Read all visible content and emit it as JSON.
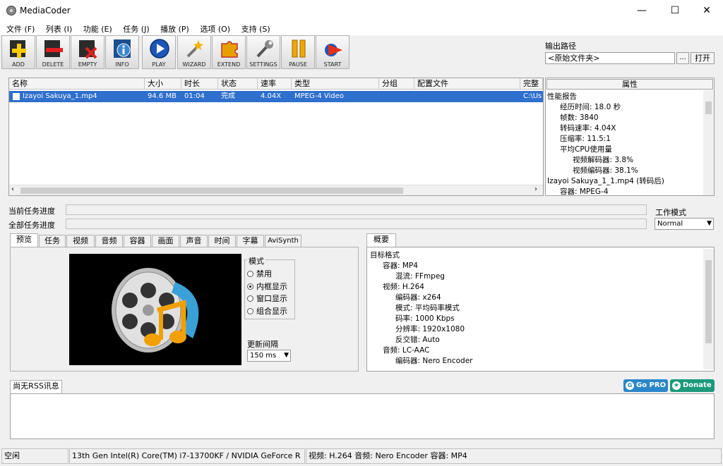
{
  "window": {
    "title": "MediaCoder",
    "minimize": "—",
    "maximize": "☐",
    "close": "✕"
  },
  "menu": [
    "文件 (F)",
    "列表 (I)",
    "功能 (E)",
    "任务 (J)",
    "播放 (P)",
    "选项 (O)",
    "支持 (S)"
  ],
  "toolbar": {
    "add": "ADD",
    "delete": "DELETE",
    "empty": "EMPTY",
    "info": "INFO",
    "play": "PLAY",
    "wizard": "WIZARD",
    "extend": "EXTEND",
    "settings": "SETTINGS",
    "pause": "PAUSE",
    "start": "START"
  },
  "output": {
    "label": "输出路径",
    "value": "<原始文件夹>",
    "browse": "...",
    "open": "打开"
  },
  "filelist": {
    "columns": [
      "名称",
      "大小",
      "时长",
      "状态",
      "速率",
      "类型",
      "分组",
      "配置文件",
      "完整"
    ],
    "rows": [
      {
        "name": "Izayoi Sakuya_1.mp4",
        "size": "94.6 MB",
        "duration": "01:04",
        "status": "完成",
        "rate": "4.04X",
        "type": "MPEG-4 Video",
        "group": "",
        "profile": "",
        "path": "C:\\Us"
      }
    ]
  },
  "properties": {
    "header": "属性",
    "items": [
      "性能报告",
      "经历时间: 18.0 秒",
      "帧数: 3840",
      "转码速率: 4.04X",
      "压缩率: 11.5:1",
      "平均CPU使用量",
      "视频解码器: 3.8%",
      "视频编码器: 38.1%",
      "Izayoi Sakuya_1_1.mp4 (转码后)",
      "容器: MPEG-4"
    ]
  },
  "progress": {
    "current_label": "当前任务进度",
    "total_label": "全部任务进度"
  },
  "work_mode": {
    "label": "工作模式",
    "value": "Normal"
  },
  "tabs": [
    "预览",
    "任务",
    "视频",
    "音频",
    "容器",
    "画面",
    "声音",
    "时间",
    "字幕",
    "AviSynth"
  ],
  "preview": {
    "mode_label": "模式",
    "modes": [
      "禁用",
      "内框显示",
      "窗口显示",
      "组合显示"
    ],
    "update_label": "更新间隔",
    "update_value": "150 ms"
  },
  "summary": {
    "tab": "概要",
    "items": [
      "目标格式",
      "容器: MP4",
      "混流: FFmpeg",
      "视频: H.264",
      "编码器: x264",
      "模式: 平均码率模式",
      "码率: 1000 Kbps",
      "分辨率: 1920x1080",
      "反交错: Auto",
      "音频: LC-AAC",
      "编码器: Nero Encoder"
    ]
  },
  "rss": {
    "tab": "尚无RSS讯息",
    "go_pro": "Go PRO",
    "donate": "Donate"
  },
  "status": {
    "state": "空闲",
    "cpu": "13th Gen Intel(R) Core(TM) i7-13700KF / NVIDIA GeForce R",
    "format": "视频: H.264  音频: Nero Encoder  容器: MP4"
  }
}
